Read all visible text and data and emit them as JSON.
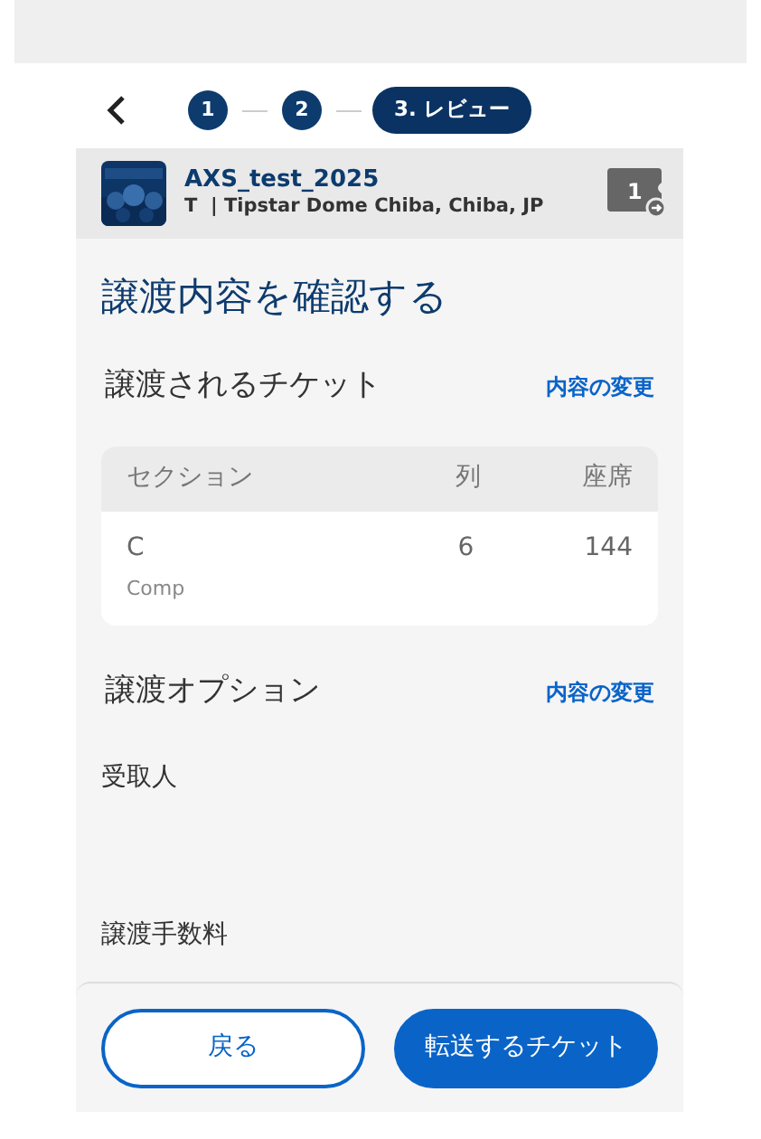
{
  "steps": [
    {
      "label": "1",
      "selected": false
    },
    {
      "label": "2",
      "selected": false
    },
    {
      "label": "3. レビュー",
      "selected": true
    }
  ],
  "event": {
    "title": "AXS_test_2025",
    "subtitle": "T  | Tipstar Dome Chiba, Chiba, JP",
    "ticket_count": "1"
  },
  "page_title": "譲渡内容を確認する",
  "tickets_section": {
    "heading": "譲渡されるチケット",
    "edit_link": "内容の変更",
    "table": {
      "columns": [
        "セクション",
        "列",
        "座席"
      ],
      "rows": [
        {
          "section": "C",
          "note": "Comp",
          "row": "6",
          "seat": "144"
        }
      ]
    }
  },
  "options_section": {
    "heading": "譲渡オプション",
    "edit_link": "内容の変更",
    "recipient_label": "受取人",
    "fee_label": "譲渡手数料"
  },
  "buttons": {
    "back": "戻る",
    "submit": "転送するチケット"
  }
}
